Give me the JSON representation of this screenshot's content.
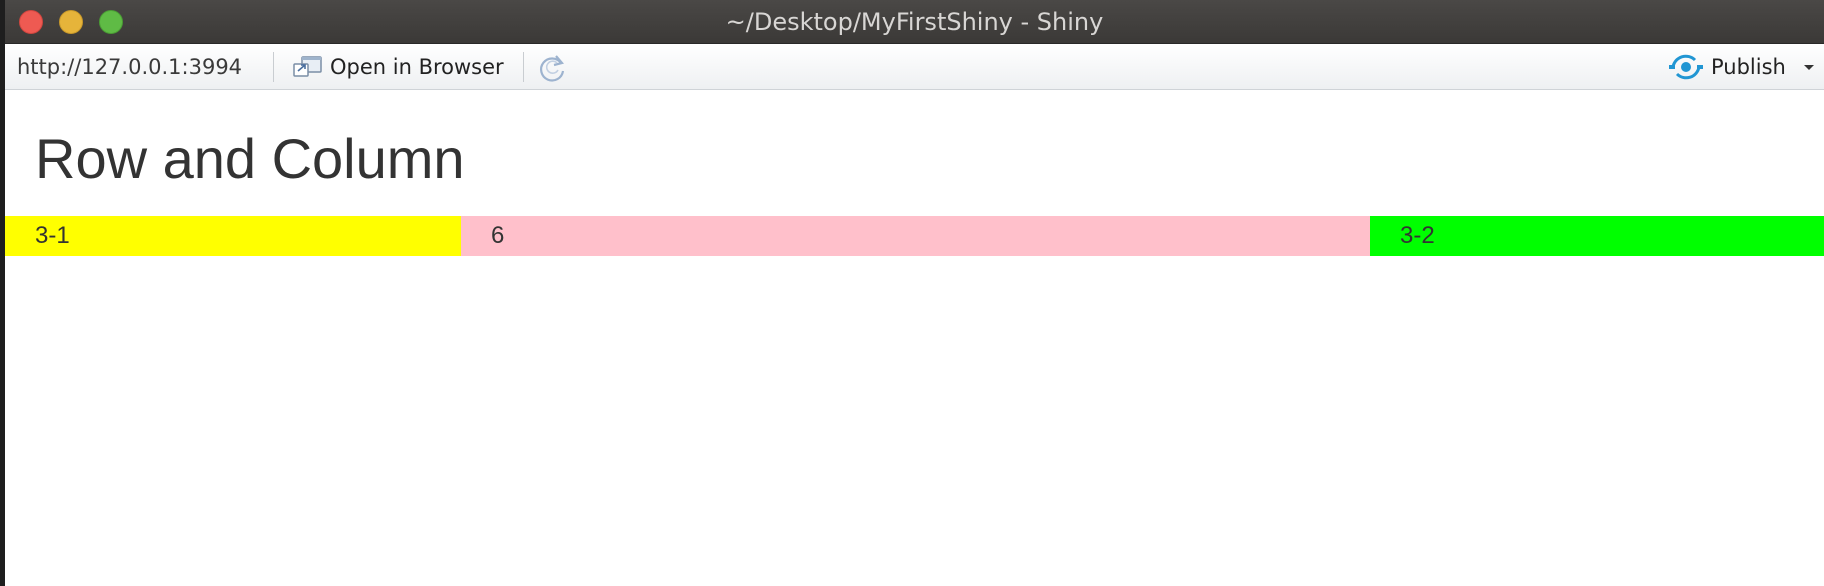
{
  "window": {
    "title": "~/Desktop/MyFirstShiny - Shiny"
  },
  "toolbar": {
    "url": "http://127.0.0.1:3994",
    "open_in_browser_label": "Open in Browser",
    "publish_label": "Publish",
    "icons": {
      "open": "open-in-browser-icon",
      "refresh": "refresh-icon",
      "publish": "publish-icon",
      "caret": "chevron-down-icon"
    }
  },
  "page": {
    "heading": "Row and Column",
    "columns": [
      {
        "label": "3-1",
        "color": "#ffff00"
      },
      {
        "label": "6",
        "color": "#ffc0cb"
      },
      {
        "label": "3-2",
        "color": "#00ff00"
      }
    ]
  },
  "colors": {
    "accent": "#2196d3"
  }
}
